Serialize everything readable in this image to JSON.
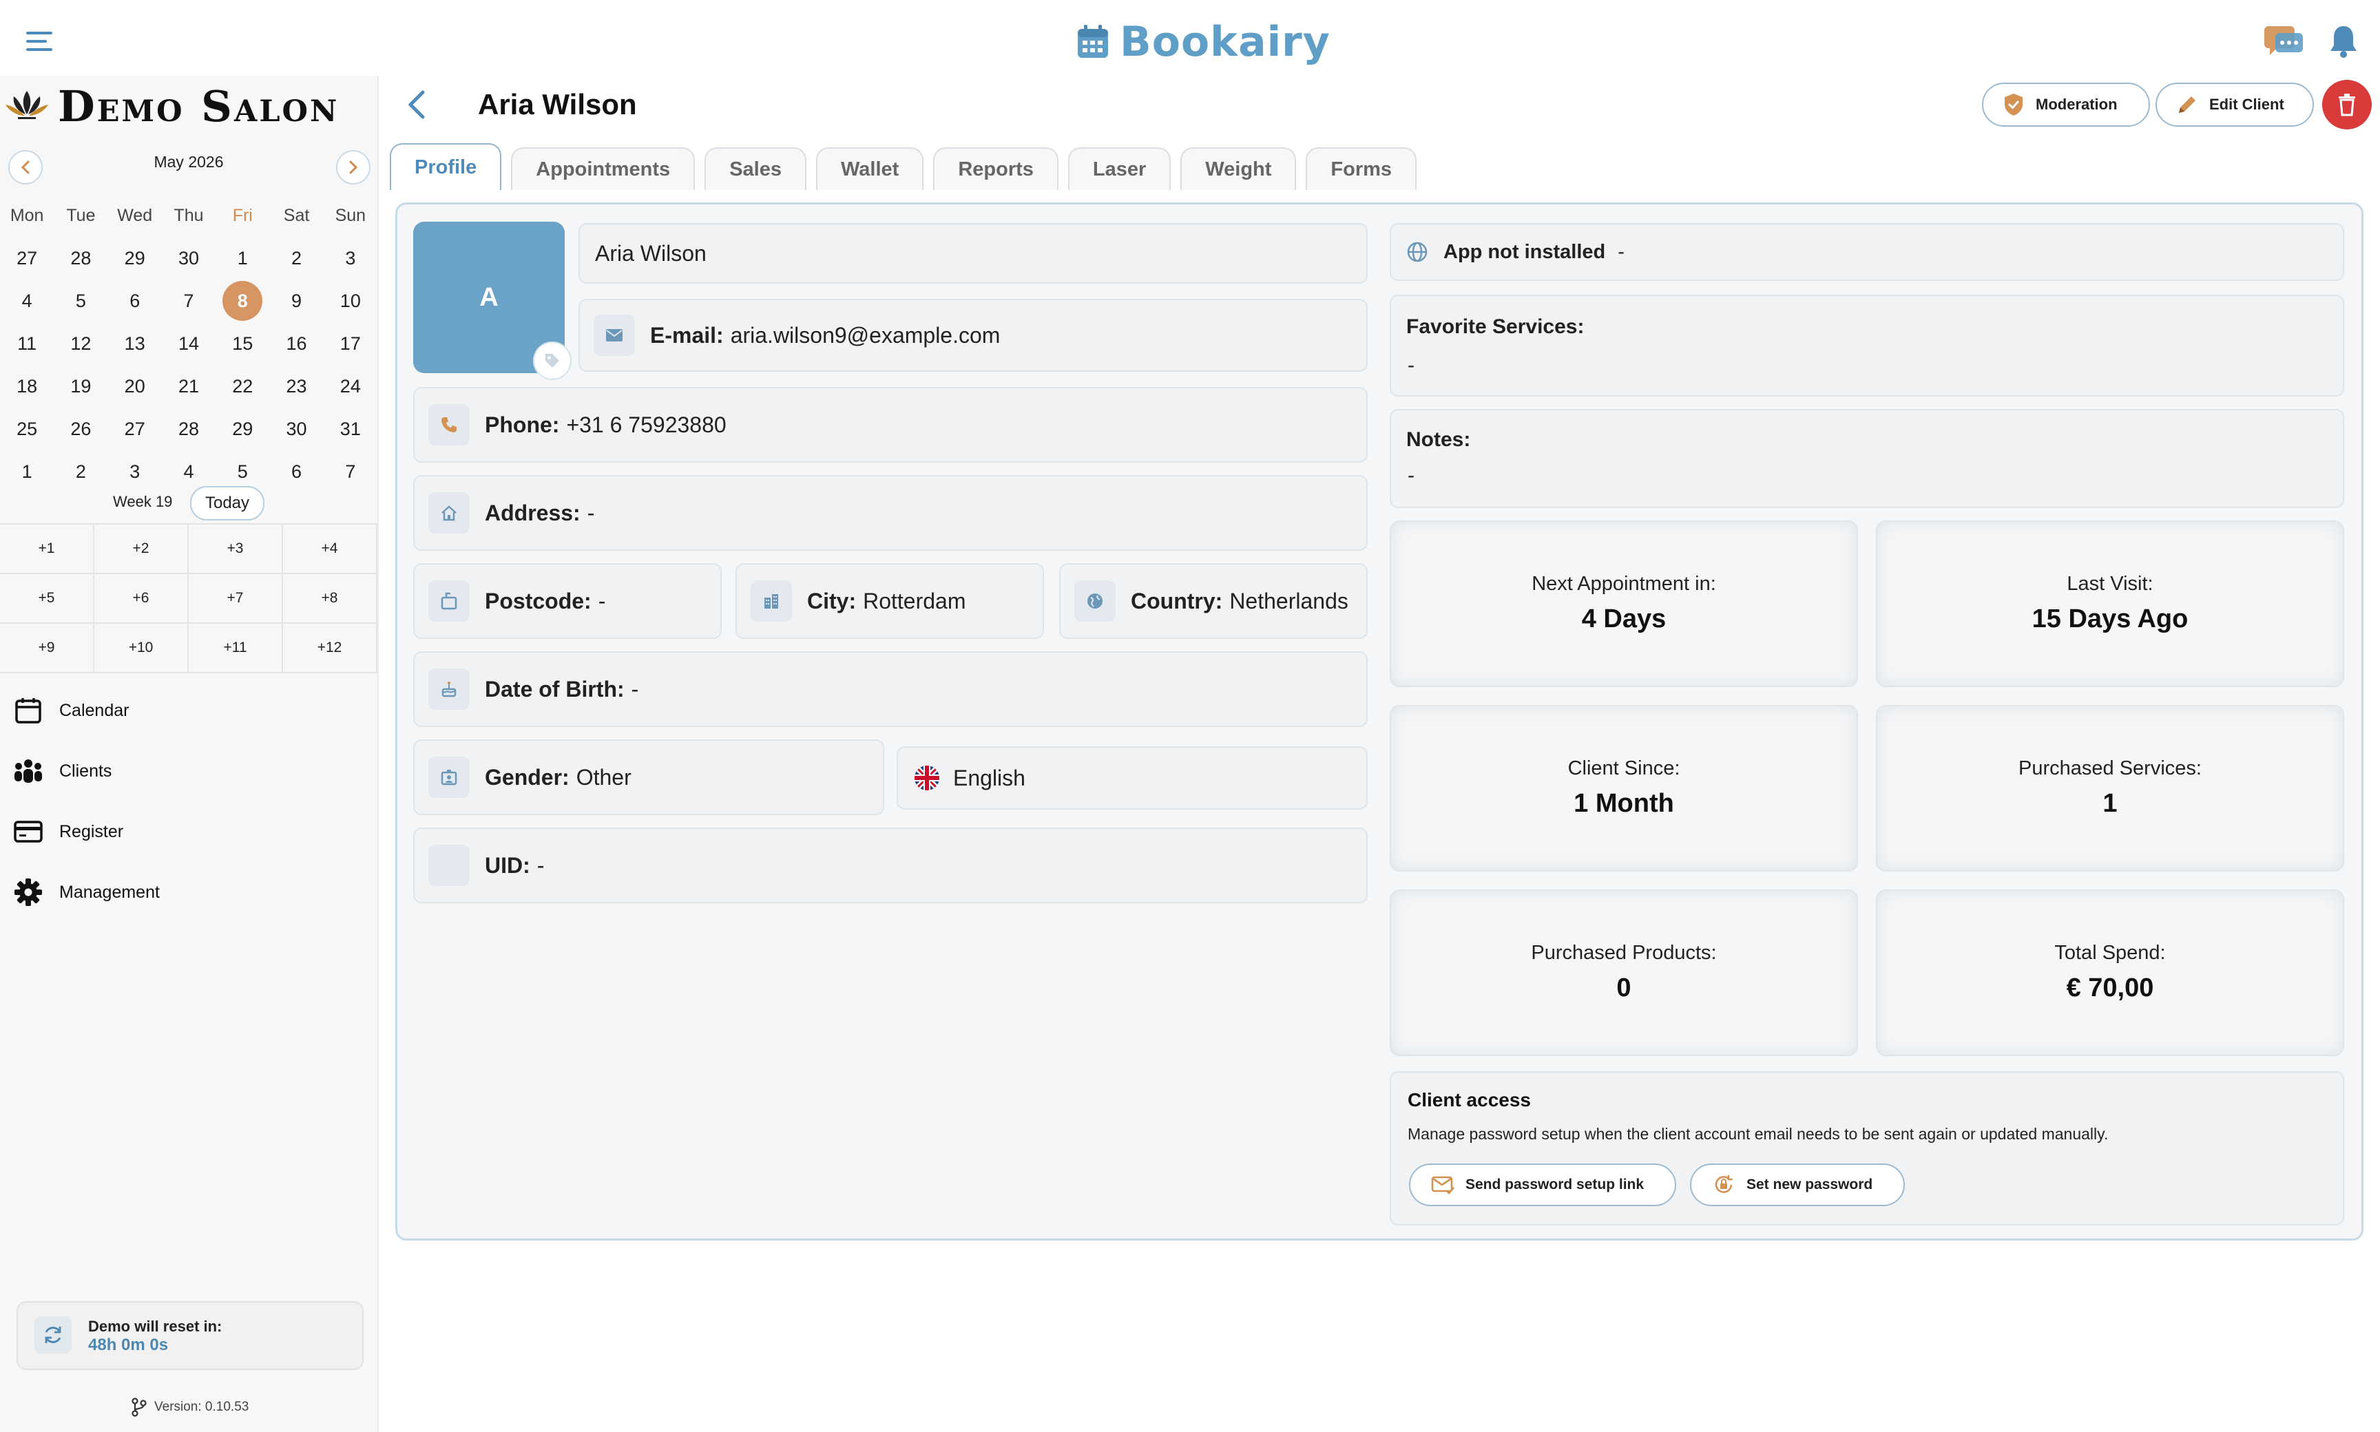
{
  "app": {
    "brand": "Bookairy"
  },
  "salon": {
    "name": "Demo Salon"
  },
  "calendar": {
    "month_label": "May 2026",
    "weekdays": [
      "Mon",
      "Tue",
      "Wed",
      "Thu",
      "Fri",
      "Sat",
      "Sun"
    ],
    "weeks": [
      [
        "27",
        "28",
        "29",
        "30",
        "1",
        "2",
        "3"
      ],
      [
        "4",
        "5",
        "6",
        "7",
        "8",
        "9",
        "10"
      ],
      [
        "11",
        "12",
        "13",
        "14",
        "15",
        "16",
        "17"
      ],
      [
        "18",
        "19",
        "20",
        "21",
        "22",
        "23",
        "24"
      ],
      [
        "25",
        "26",
        "27",
        "28",
        "29",
        "30",
        "31"
      ],
      [
        "1",
        "2",
        "3",
        "4",
        "5",
        "6",
        "7"
      ]
    ],
    "selected_day": "8",
    "week_label": "Week 19",
    "today_label": "Today",
    "quick_jumps": [
      "+1",
      "+2",
      "+3",
      "+4",
      "+5",
      "+6",
      "+7",
      "+8",
      "+9",
      "+10",
      "+11",
      "+12"
    ]
  },
  "nav": {
    "items": [
      {
        "label": "Calendar",
        "icon": "calendar-icon"
      },
      {
        "label": "Clients",
        "icon": "users-icon"
      },
      {
        "label": "Register",
        "icon": "credit-card-icon"
      },
      {
        "label": "Management",
        "icon": "gear-icon"
      }
    ]
  },
  "demo_reset": {
    "title": "Demo will reset in:",
    "time": "48h 0m 0s"
  },
  "version": "Version: 0.10.53",
  "header": {
    "client_name": "Aria Wilson",
    "moderation_label": "Moderation",
    "edit_label": "Edit Client"
  },
  "tabs": [
    "Profile",
    "Appointments",
    "Sales",
    "Wallet",
    "Reports",
    "Laser",
    "Weight",
    "Forms"
  ],
  "active_tab": "Profile",
  "profile": {
    "avatar_initial": "A",
    "name": "Aria Wilson",
    "email_label": "E-mail:",
    "email": "aria.wilson9@example.com",
    "phone_label": "Phone:",
    "phone": "+31 6 75923880",
    "address_label": "Address:",
    "address": "-",
    "postcode_label": "Postcode:",
    "postcode": "-",
    "city_label": "City:",
    "city": "Rotterdam",
    "country_label": "Country:",
    "country": "Netherlands",
    "dob_label": "Date of Birth:",
    "dob": "-",
    "gender_label": "Gender:",
    "gender": "Other",
    "language": "English",
    "uid_label": "UID:",
    "uid": "-"
  },
  "app_status": {
    "label": "App not installed",
    "value": "-"
  },
  "favorite_services": {
    "label": "Favorite Services:",
    "value": "-"
  },
  "notes": {
    "label": "Notes:",
    "value": "-"
  },
  "stats": [
    {
      "label": "Next Appointment in:",
      "value": "4 Days"
    },
    {
      "label": "Last Visit:",
      "value": "15 Days Ago"
    },
    {
      "label": "Client Since:",
      "value": "1 Month"
    },
    {
      "label": "Purchased Services:",
      "value": "1"
    },
    {
      "label": "Purchased Products:",
      "value": "0"
    },
    {
      "label": "Total Spend:",
      "value": "€ 70,00"
    }
  ],
  "client_access": {
    "title": "Client access",
    "description": "Manage password setup when the client account email needs to be sent again or updated manually.",
    "send_link_label": "Send password setup link",
    "set_password_label": "Set new password"
  },
  "colors": {
    "accent": "#5f9ec6",
    "selected_day": "#d69563",
    "danger": "#d93a3a",
    "avatar": "#6aa3c7"
  }
}
